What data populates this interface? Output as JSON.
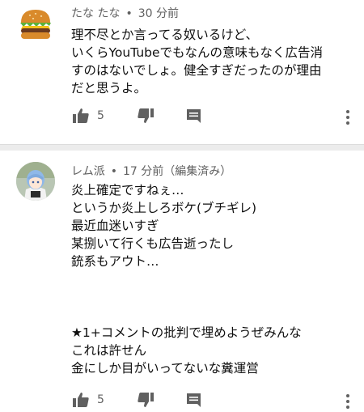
{
  "comments": [
    {
      "author": "たな たな",
      "time": "30 分前",
      "lines": [
        "理不尽とか言ってる奴いるけど、",
        "いくらYouTubeでもなんの意味もなく広告消",
        "すのはないでしょ。健全すぎだったのが理由",
        "だと思うよ。"
      ],
      "likes": "5",
      "avatar_icon": "hamburger-icon"
    },
    {
      "author": "レム派",
      "time": "17 分前（編集済み）",
      "lines_top": [
        "炎上確定ですねぇ…",
        "というか炎上しろボケ(ブチギレ)",
        "最近血迷いすぎ",
        "某捌いて行くも広告逝ったし",
        "銃系もアウト…"
      ],
      "lines_bottom": [
        "★1+コメントの批判で埋めようぜみんな",
        "これは許せん",
        "金にしか目がいってないな糞運営"
      ],
      "likes": "5",
      "avatar_icon": "anime-character-avatar"
    }
  ],
  "icons": {
    "like": "thumbs-up-icon",
    "dislike": "thumbs-down-icon",
    "reply": "reply-comment-icon",
    "more": "more-vertical-icon"
  },
  "colors": {
    "text": "#0f0f0f",
    "secondary": "#606060",
    "divider": "#ececec"
  }
}
